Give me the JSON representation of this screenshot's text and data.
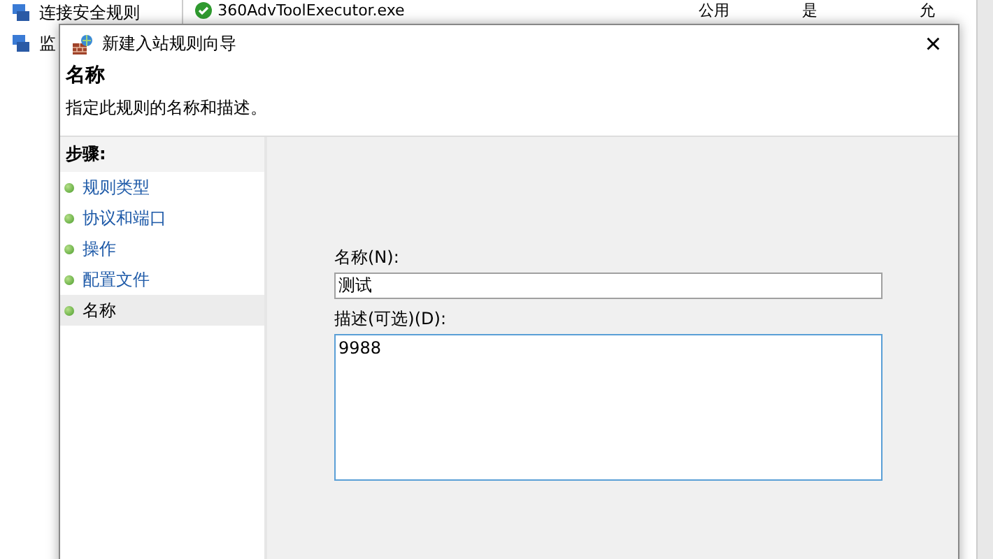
{
  "background_window": {
    "tree_items": [
      {
        "label": "连接安全规则"
      },
      {
        "label": "监"
      }
    ],
    "table_rows": [
      {
        "cells": [
          "360AdvToolExecutor.exe",
          "公用",
          "是",
          "允"
        ]
      }
    ]
  },
  "dialog": {
    "title": "新建入站规则向导",
    "close": "×",
    "heading": "名称",
    "subtitle": "指定此规则的名称和描述。",
    "steps_title": "步骤:",
    "steps": [
      {
        "label": "规则类型",
        "selected": false
      },
      {
        "label": "协议和端口",
        "selected": false
      },
      {
        "label": "操作",
        "selected": false
      },
      {
        "label": "配置文件",
        "selected": false
      },
      {
        "label": "名称",
        "selected": true
      }
    ],
    "name_label": "名称(N):",
    "name_value": "测试",
    "description_label": "描述(可选)(D):",
    "description_value": "9988"
  }
}
